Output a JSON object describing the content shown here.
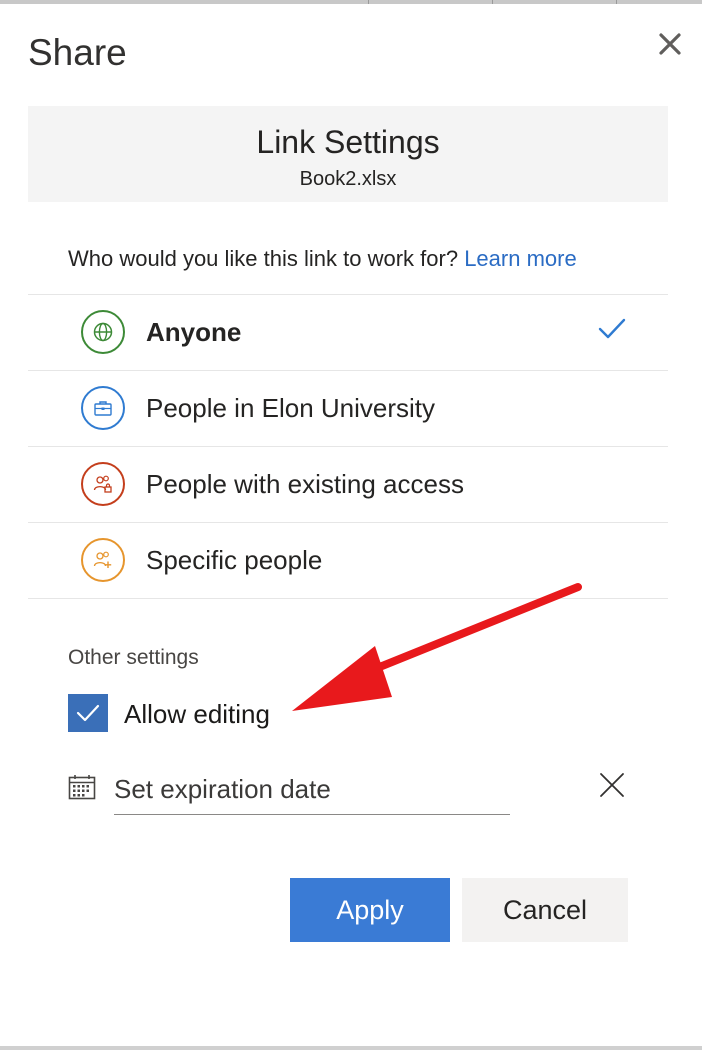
{
  "dialog": {
    "title": "Share",
    "header_title": "Link Settings",
    "file_name": "Book2.xlsx"
  },
  "audience": {
    "question": "Who would you like this link to work for?",
    "learn_more": "Learn more",
    "options": [
      {
        "label": "Anyone",
        "icon": "globe-icon",
        "color": "#3d8a37",
        "selected": true
      },
      {
        "label": "People in Elon University",
        "icon": "briefcase-icon",
        "color": "#2f7bd1",
        "selected": false
      },
      {
        "label": "People with existing access",
        "icon": "people-lock-icon",
        "color": "#c43e1c",
        "selected": false
      },
      {
        "label": "Specific people",
        "icon": "people-add-icon",
        "color": "#e6952d",
        "selected": false
      }
    ]
  },
  "other_settings": {
    "heading": "Other settings",
    "allow_editing": {
      "label": "Allow editing",
      "checked": true
    },
    "expiration": {
      "placeholder": "Set expiration date"
    }
  },
  "buttons": {
    "apply": "Apply",
    "cancel": "Cancel"
  },
  "colors": {
    "accent": "#3a7bd5",
    "checkbox": "#3a6fb8",
    "link": "#2b6cc4",
    "annotation_arrow": "#e8191c"
  }
}
